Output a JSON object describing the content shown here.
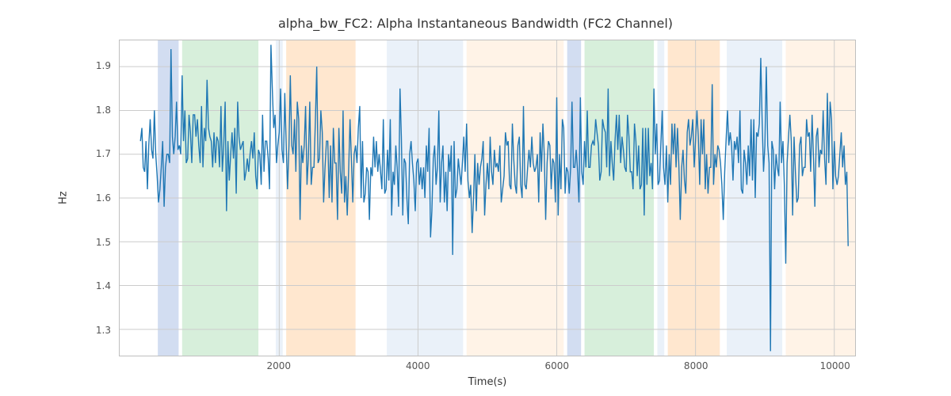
{
  "chart_data": {
    "type": "line",
    "title": "alpha_bw_FC2: Alpha Instantaneous Bandwidth (FC2 Channel)",
    "xlabel": "Time(s)",
    "ylabel": "Hz",
    "xlim": [
      -300,
      10300
    ],
    "ylim": [
      1.24,
      1.96
    ],
    "x_ticks": [
      2000,
      4000,
      6000,
      8000,
      10000
    ],
    "y_ticks": [
      1.3,
      1.4,
      1.5,
      1.6,
      1.7,
      1.8,
      1.9
    ],
    "background_spans": [
      {
        "x0": 250,
        "x1": 550,
        "color": "blue"
      },
      {
        "x0": 600,
        "x1": 1700,
        "color": "green"
      },
      {
        "x0": 1950,
        "x1": 2050,
        "color": "lblue"
      },
      {
        "x0": 2100,
        "x1": 3100,
        "color": "orange"
      },
      {
        "x0": 3550,
        "x1": 4050,
        "color": "lblue"
      },
      {
        "x0": 4050,
        "x1": 4650,
        "color": "lblue"
      },
      {
        "x0": 4700,
        "x1": 6100,
        "color": "lorange"
      },
      {
        "x0": 6150,
        "x1": 6350,
        "color": "blue"
      },
      {
        "x0": 6400,
        "x1": 7400,
        "color": "green"
      },
      {
        "x0": 7450,
        "x1": 7550,
        "color": "lblue"
      },
      {
        "x0": 7600,
        "x1": 8350,
        "color": "orange"
      },
      {
        "x0": 8450,
        "x1": 9250,
        "color": "lblue"
      },
      {
        "x0": 9300,
        "x1": 10300,
        "color": "lorange"
      }
    ],
    "series": [
      {
        "name": "alpha_bw_FC2",
        "x_start": 0,
        "x_step": 20,
        "values": [
          1.73,
          1.76,
          1.67,
          1.66,
          1.73,
          1.62,
          1.72,
          1.78,
          1.71,
          1.69,
          1.8,
          1.7,
          1.65,
          1.59,
          1.62,
          1.67,
          1.73,
          1.58,
          1.67,
          1.7,
          1.7,
          1.68,
          1.94,
          1.74,
          1.7,
          1.74,
          1.82,
          1.71,
          1.72,
          1.7,
          1.88,
          1.73,
          1.8,
          1.68,
          1.69,
          1.79,
          1.75,
          1.68,
          1.79,
          1.79,
          1.74,
          1.78,
          1.72,
          1.68,
          1.81,
          1.67,
          1.76,
          1.73,
          1.87,
          1.76,
          1.74,
          1.73,
          1.67,
          1.75,
          1.68,
          1.74,
          1.73,
          1.67,
          1.81,
          1.66,
          1.72,
          1.82,
          1.57,
          1.73,
          1.64,
          1.7,
          1.75,
          1.69,
          1.76,
          1.61,
          1.82,
          1.74,
          1.71,
          1.72,
          1.73,
          1.64,
          1.66,
          1.69,
          1.66,
          1.7,
          1.73,
          1.69,
          1.75,
          1.65,
          1.62,
          1.71,
          1.7,
          1.63,
          1.79,
          1.66,
          1.73,
          1.73,
          1.69,
          1.62,
          1.95,
          1.85,
          1.76,
          1.79,
          1.68,
          1.72,
          1.75,
          1.85,
          1.71,
          1.68,
          1.84,
          1.72,
          1.62,
          1.72,
          1.88,
          1.72,
          1.7,
          1.78,
          1.66,
          1.82,
          1.78,
          1.55,
          1.72,
          1.68,
          1.72,
          1.81,
          1.63,
          1.69,
          1.82,
          1.63,
          1.67,
          1.67,
          1.77,
          1.9,
          1.68,
          1.69,
          1.8,
          1.75,
          1.59,
          1.67,
          1.73,
          1.73,
          1.6,
          1.72,
          1.59,
          1.76,
          1.68,
          1.68,
          1.55,
          1.76,
          1.66,
          1.61,
          1.8,
          1.59,
          1.65,
          1.56,
          1.66,
          1.78,
          1.69,
          1.59,
          1.7,
          1.72,
          1.68,
          1.76,
          1.81,
          1.6,
          1.73,
          1.59,
          1.61,
          1.67,
          1.66,
          1.55,
          1.67,
          1.65,
          1.74,
          1.67,
          1.73,
          1.66,
          1.7,
          1.66,
          1.62,
          1.78,
          1.61,
          1.62,
          1.71,
          1.64,
          1.78,
          1.56,
          1.66,
          1.63,
          1.72,
          1.67,
          1.58,
          1.85,
          1.74,
          1.56,
          1.69,
          1.68,
          1.6,
          1.54,
          1.7,
          1.73,
          1.68,
          1.64,
          1.57,
          1.68,
          1.69,
          1.63,
          1.67,
          1.62,
          1.67,
          1.6,
          1.72,
          1.66,
          1.76,
          1.51,
          1.57,
          1.69,
          1.72,
          1.63,
          1.67,
          1.8,
          1.59,
          1.68,
          1.72,
          1.59,
          1.66,
          1.57,
          1.7,
          1.66,
          1.72,
          1.47,
          1.73,
          1.6,
          1.62,
          1.69,
          1.66,
          1.63,
          1.68,
          1.74,
          1.66,
          1.77,
          1.64,
          1.6,
          1.63,
          1.52,
          1.6,
          1.7,
          1.57,
          1.68,
          1.63,
          1.67,
          1.69,
          1.73,
          1.56,
          1.63,
          1.68,
          1.62,
          1.74,
          1.66,
          1.63,
          1.71,
          1.67,
          1.68,
          1.66,
          1.72,
          1.59,
          1.62,
          1.65,
          1.75,
          1.72,
          1.73,
          1.63,
          1.62,
          1.77,
          1.69,
          1.63,
          1.61,
          1.72,
          1.74,
          1.63,
          1.6,
          1.81,
          1.63,
          1.62,
          1.67,
          1.71,
          1.67,
          1.74,
          1.68,
          1.66,
          1.67,
          1.7,
          1.59,
          1.75,
          1.66,
          1.77,
          1.7,
          1.55,
          1.68,
          1.73,
          1.72,
          1.62,
          1.69,
          1.68,
          1.59,
          1.83,
          1.56,
          1.7,
          1.62,
          1.78,
          1.76,
          1.61,
          1.67,
          1.66,
          1.61,
          1.67,
          1.82,
          1.67,
          1.67,
          1.71,
          1.66,
          1.59,
          1.83,
          1.66,
          1.63,
          1.73,
          1.67,
          1.8,
          1.67,
          1.67,
          1.72,
          1.73,
          1.72,
          1.78,
          1.75,
          1.72,
          1.64,
          1.66,
          1.78,
          1.76,
          1.75,
          1.67,
          1.85,
          1.65,
          1.73,
          1.68,
          1.64,
          1.73,
          1.79,
          1.71,
          1.79,
          1.68,
          1.74,
          1.71,
          1.67,
          1.66,
          1.79,
          1.74,
          1.66,
          1.66,
          1.62,
          1.77,
          1.73,
          1.65,
          1.72,
          1.62,
          1.63,
          1.76,
          1.56,
          1.76,
          1.63,
          1.76,
          1.65,
          1.68,
          1.62,
          1.85,
          1.7,
          1.77,
          1.63,
          1.64,
          1.72,
          1.8,
          1.67,
          1.63,
          1.72,
          1.59,
          1.7,
          1.63,
          1.77,
          1.7,
          1.77,
          1.67,
          1.76,
          1.67,
          1.55,
          1.67,
          1.71,
          1.64,
          1.61,
          1.75,
          1.78,
          1.72,
          1.74,
          1.78,
          1.67,
          1.73,
          1.8,
          1.74,
          1.63,
          1.78,
          1.7,
          1.78,
          1.62,
          1.7,
          1.61,
          1.67,
          1.67,
          1.86,
          1.63,
          1.7,
          1.67,
          1.72,
          1.71,
          1.68,
          1.63,
          1.55,
          1.66,
          1.73,
          1.8,
          1.72,
          1.75,
          1.72,
          1.64,
          1.73,
          1.71,
          1.74,
          1.68,
          1.8,
          1.62,
          1.61,
          1.71,
          1.68,
          1.63,
          1.72,
          1.65,
          1.78,
          1.64,
          1.78,
          1.6,
          1.75,
          1.74,
          1.77,
          1.92,
          1.78,
          1.66,
          1.72,
          1.9,
          1.72,
          1.68,
          1.25,
          1.73,
          1.71,
          1.62,
          1.7,
          1.67,
          1.65,
          1.82,
          1.68,
          1.73,
          1.63,
          1.45,
          1.68,
          1.74,
          1.79,
          1.73,
          1.56,
          1.74,
          1.66,
          1.59,
          1.6,
          1.72,
          1.74,
          1.65,
          1.67,
          1.67,
          1.78,
          1.74,
          1.75,
          1.66,
          1.79,
          1.69,
          1.58,
          1.74,
          1.76,
          1.67,
          1.71,
          1.7,
          1.8,
          1.69,
          1.63,
          1.84,
          1.68,
          1.82,
          1.78,
          1.62,
          1.73,
          1.65,
          1.63,
          1.65,
          1.7,
          1.75,
          1.67,
          1.72,
          1.63,
          1.66,
          1.49
        ]
      }
    ]
  }
}
